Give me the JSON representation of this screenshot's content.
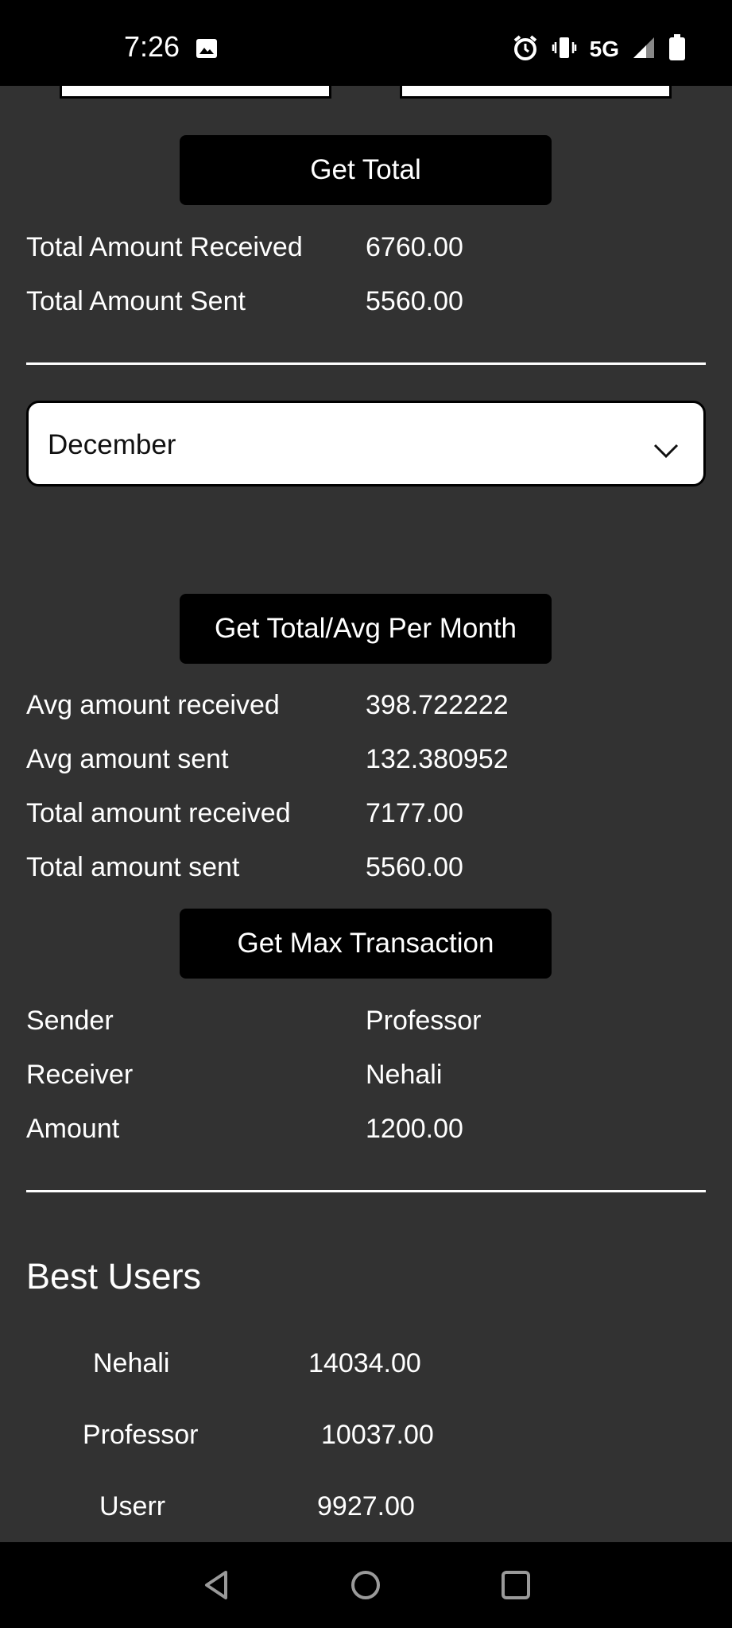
{
  "status_bar": {
    "time": "7:26",
    "network": "5G",
    "icons": [
      "image-icon",
      "alarm-icon",
      "vibrate-icon",
      "signal-icon",
      "battery-icon"
    ]
  },
  "total_section": {
    "button_label": "Get Total",
    "rows": [
      {
        "label": "Total Amount Received",
        "value": "6760.00"
      },
      {
        "label": "Total Amount Sent",
        "value": "5560.00"
      }
    ]
  },
  "month_select": {
    "selected": "December"
  },
  "monthly_section": {
    "button_label": "Get Total/Avg Per Month",
    "rows": [
      {
        "label": "Avg amount received",
        "value": "398.722222"
      },
      {
        "label": "Avg amount sent",
        "value": "132.380952"
      },
      {
        "label": "Total amount received",
        "value": "7177.00"
      },
      {
        "label": "Total amount sent",
        "value": "5560.00"
      }
    ]
  },
  "max_section": {
    "button_label": "Get Max Transaction",
    "rows": [
      {
        "label": "Sender",
        "value": "Professor"
      },
      {
        "label": "Receiver",
        "value": "Nehali"
      },
      {
        "label": "Amount",
        "value": "1200.00"
      }
    ]
  },
  "best_users": {
    "title": "Best Users",
    "users": [
      {
        "name": "Nehali",
        "amount": "14034.00"
      },
      {
        "name": "Professor",
        "amount": "10037.00"
      },
      {
        "name": "Userr",
        "amount": "9927.00"
      }
    ]
  },
  "nav_bar": {
    "icons": [
      "back-icon",
      "home-icon",
      "recents-icon"
    ]
  }
}
